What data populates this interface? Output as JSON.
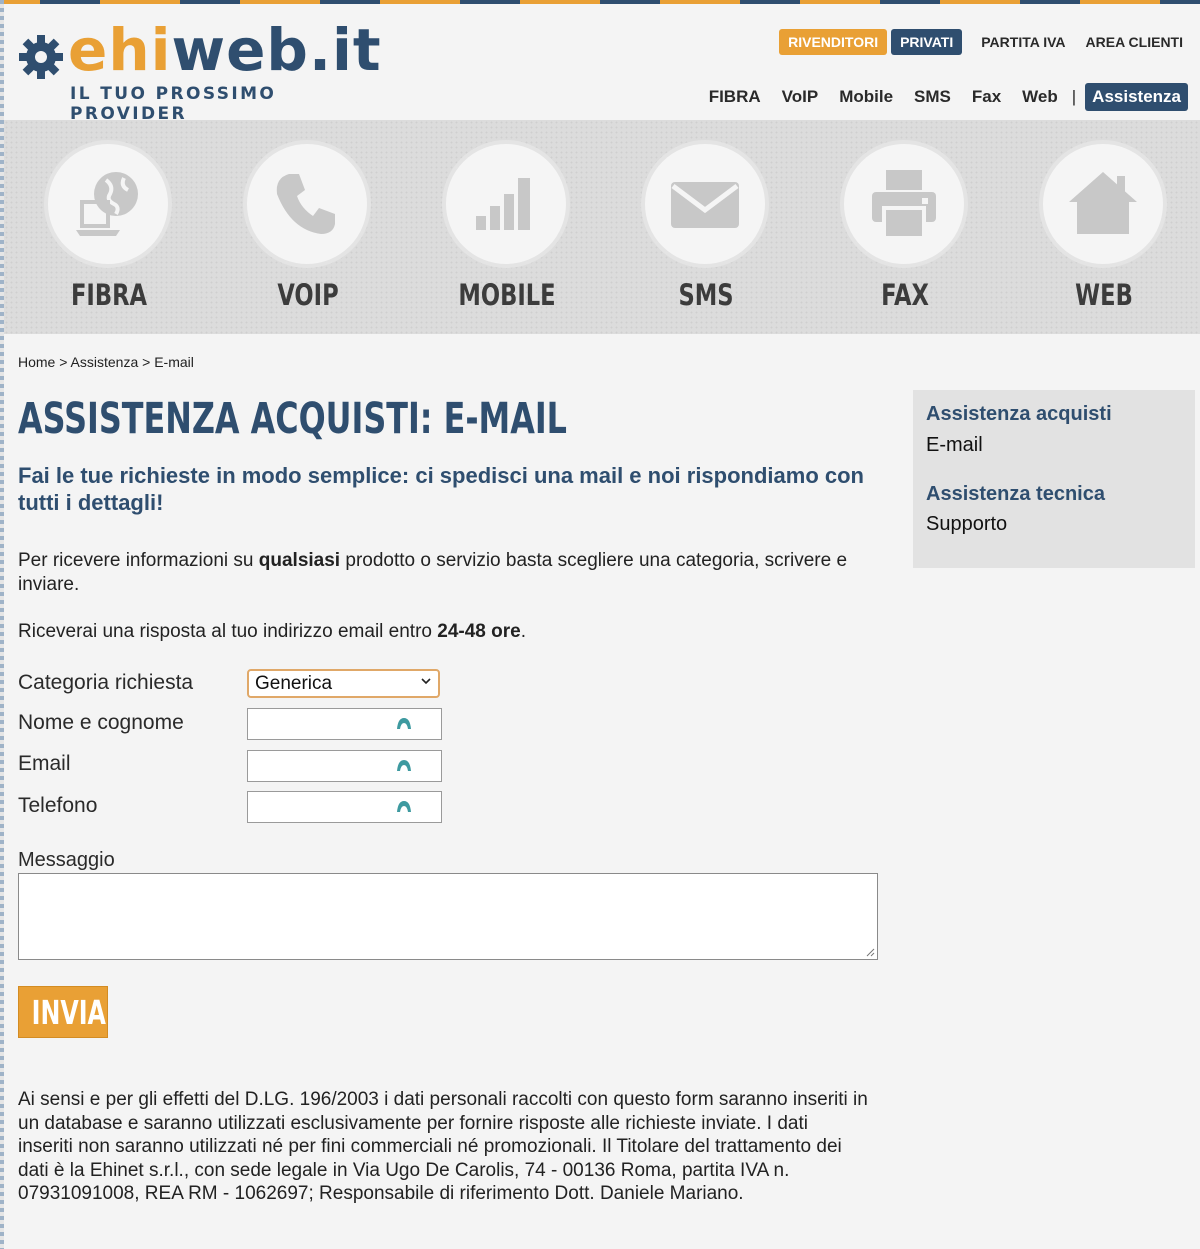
{
  "header": {
    "logo_text_part1": "ehi",
    "logo_text_part2": "web",
    "logo_text_part3": ".it",
    "tagline": "IL TUO PROSSIMO PROVIDER",
    "top_links": {
      "rivenditori": "RIVENDITORI",
      "privati": "PRIVATI",
      "partita_iva": "PARTITA IVA",
      "area_clienti": "AREA CLIENTI"
    },
    "nav": {
      "fibra": "FIBRA",
      "voip": "VoIP",
      "mobile": "Mobile",
      "sms": "SMS",
      "fax": "Fax",
      "web": "Web",
      "separator": "|",
      "assistenza": "Assistenza"
    }
  },
  "services": [
    {
      "label": "FIBRA",
      "icon": "globe-laptop-icon"
    },
    {
      "label": "VOIP",
      "icon": "phone-icon"
    },
    {
      "label": "MOBILE",
      "icon": "signal-bars-icon"
    },
    {
      "label": "SMS",
      "icon": "envelope-icon"
    },
    {
      "label": "FAX",
      "icon": "printer-icon"
    },
    {
      "label": "WEB",
      "icon": "house-icon"
    }
  ],
  "breadcrumb": {
    "home": "Home",
    "sep": " > ",
    "assistenza": "Assistenza",
    "current": "E-mail"
  },
  "main": {
    "title": "ASSISTENZA ACQUISTI: E-MAIL",
    "subtitle": "Fai le tue richieste in modo semplice: ci spedisci una mail e noi rispondiamo con tutti i dettagli!",
    "p1_a": "Per ricevere informazioni su ",
    "p1_bold": "qualsiasi",
    "p1_b": " prodotto o servizio basta scegliere una categoria, scrivere e inviare.",
    "p2_a": "Riceverai una risposta al tuo indirizzo email entro ",
    "p2_bold": "24-48 ore",
    "p2_b": "."
  },
  "form": {
    "category_label": "Categoria richiesta",
    "category_value": "Generica",
    "name_label": "Nome e cognome",
    "name_value": "",
    "email_label": "Email",
    "email_value": "",
    "phone_label": "Telefono",
    "phone_value": "",
    "message_label": "Messaggio",
    "message_value": "",
    "submit_label": "INVIA"
  },
  "privacy": "Ai sensi e per gli effetti del D.LG. 196/2003 i dati personali raccolti con questo form saranno inseriti in un database e saranno utilizzati esclusivamente per fornire risposte alle richieste inviate. I dati inseriti non saranno utilizzati né per fini commerciali né promozionali. Il Titolare del trattamento dei dati è la Ehinet s.r.l., con sede legale in Via Ugo De Carolis, 74 - 00136 Roma, partita IVA n. 07931091008, REA RM - 1062697; Responsabile di riferimento Dott. Daniele Mariano.",
  "sidebar": {
    "head1": "Assistenza acquisti",
    "link1": "E-mail",
    "head2": "Assistenza tecnica",
    "link2": "Supporto"
  },
  "colors": {
    "brand_orange": "#e9a035",
    "brand_navy": "#2f4e6f"
  }
}
